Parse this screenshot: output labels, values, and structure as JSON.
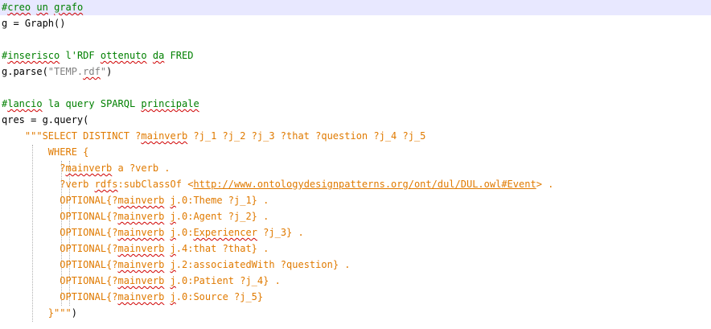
{
  "editor": {
    "lines": [
      {
        "segments": [
          {
            "text": "#",
            "cls": "comment"
          },
          {
            "text": "creo",
            "cls": "comment squiggle"
          },
          {
            "text": " ",
            "cls": "comment"
          },
          {
            "text": "un",
            "cls": "comment squiggle"
          },
          {
            "text": " ",
            "cls": "comment"
          },
          {
            "text": "grafo",
            "cls": "comment squiggle"
          }
        ]
      },
      {
        "segments": [
          {
            "text": "g = Graph()",
            "cls": "kw"
          }
        ]
      },
      {
        "segments": []
      },
      {
        "segments": [
          {
            "text": "#",
            "cls": "comment"
          },
          {
            "text": "inserisco",
            "cls": "comment squiggle"
          },
          {
            "text": " l'RDF ",
            "cls": "comment"
          },
          {
            "text": "ottenuto",
            "cls": "comment squiggle"
          },
          {
            "text": " ",
            "cls": "comment"
          },
          {
            "text": "da",
            "cls": "comment squiggle"
          },
          {
            "text": " FRED",
            "cls": "comment"
          }
        ]
      },
      {
        "segments": [
          {
            "text": "g.parse(",
            "cls": "kw"
          },
          {
            "text": "\"TEMP.",
            "cls": "gray"
          },
          {
            "text": "rdf",
            "cls": "gray squiggle"
          },
          {
            "text": "\"",
            "cls": "gray"
          },
          {
            "text": ")",
            "cls": "kw"
          }
        ]
      },
      {
        "segments": []
      },
      {
        "segments": [
          {
            "text": "#",
            "cls": "comment"
          },
          {
            "text": "lancio",
            "cls": "comment squiggle"
          },
          {
            "text": " la query SPARQL ",
            "cls": "comment"
          },
          {
            "text": "principale",
            "cls": "comment squiggle"
          }
        ]
      },
      {
        "segments": [
          {
            "text": "qres = g.query(",
            "cls": "kw"
          }
        ]
      },
      {
        "segments": [
          {
            "text": "    \"\"\"SELECT DISTINCT ?",
            "cls": "string"
          },
          {
            "text": "mainverb",
            "cls": "string squiggle"
          },
          {
            "text": " ?j_1 ?j_2 ?j_3 ?that ?question ?j_4 ?j_5",
            "cls": "string"
          }
        ]
      },
      {
        "segments": [
          {
            "text": "        WHERE {",
            "cls": "string"
          }
        ]
      },
      {
        "segments": [
          {
            "text": "          ?",
            "cls": "string"
          },
          {
            "text": "mainverb",
            "cls": "string squiggle"
          },
          {
            "text": " a ?verb .",
            "cls": "string"
          }
        ]
      },
      {
        "segments": [
          {
            "text": "          ?verb ",
            "cls": "string"
          },
          {
            "text": "rdfs",
            "cls": "string squiggle"
          },
          {
            "text": ":subClassOf <",
            "cls": "string"
          },
          {
            "text": "http://www.ontologydesignpatterns.org/ont/dul/DUL.owl#Event",
            "cls": "string link"
          },
          {
            "text": "> .",
            "cls": "string"
          }
        ]
      },
      {
        "segments": [
          {
            "text": "          OPTIONAL{?",
            "cls": "string"
          },
          {
            "text": "mainverb",
            "cls": "string squiggle"
          },
          {
            "text": " ",
            "cls": "string"
          },
          {
            "text": "j",
            "cls": "string squiggle"
          },
          {
            "text": ".0:Theme ?j_1} .",
            "cls": "string"
          }
        ]
      },
      {
        "segments": [
          {
            "text": "          OPTIONAL{?",
            "cls": "string"
          },
          {
            "text": "mainverb",
            "cls": "string squiggle"
          },
          {
            "text": " ",
            "cls": "string"
          },
          {
            "text": "j",
            "cls": "string squiggle"
          },
          {
            "text": ".0:Agent ?j_2} .",
            "cls": "string"
          }
        ]
      },
      {
        "segments": [
          {
            "text": "          OPTIONAL{?",
            "cls": "string"
          },
          {
            "text": "mainverb",
            "cls": "string squiggle"
          },
          {
            "text": " ",
            "cls": "string"
          },
          {
            "text": "j",
            "cls": "string squiggle"
          },
          {
            "text": ".0:",
            "cls": "string"
          },
          {
            "text": "Experiencer",
            "cls": "string squiggle"
          },
          {
            "text": " ?j_3} .",
            "cls": "string"
          }
        ]
      },
      {
        "segments": [
          {
            "text": "          OPTIONAL{?",
            "cls": "string"
          },
          {
            "text": "mainverb",
            "cls": "string squiggle"
          },
          {
            "text": " ",
            "cls": "string"
          },
          {
            "text": "j",
            "cls": "string squiggle"
          },
          {
            "text": ".4:that ?that} .",
            "cls": "string"
          }
        ]
      },
      {
        "segments": [
          {
            "text": "          OPTIONAL{?",
            "cls": "string"
          },
          {
            "text": "mainverb",
            "cls": "string squiggle"
          },
          {
            "text": " ",
            "cls": "string"
          },
          {
            "text": "j",
            "cls": "string squiggle"
          },
          {
            "text": ".2:associatedWith ?question} .",
            "cls": "string"
          }
        ]
      },
      {
        "segments": [
          {
            "text": "          OPTIONAL{?",
            "cls": "string"
          },
          {
            "text": "mainverb",
            "cls": "string squiggle"
          },
          {
            "text": " ",
            "cls": "string"
          },
          {
            "text": "j",
            "cls": "string squiggle"
          },
          {
            "text": ".0:Patient ?j_4} .",
            "cls": "string"
          }
        ]
      },
      {
        "segments": [
          {
            "text": "          OPTIONAL{?",
            "cls": "string"
          },
          {
            "text": "mainverb",
            "cls": "string squiggle"
          },
          {
            "text": " ",
            "cls": "string"
          },
          {
            "text": "j",
            "cls": "string squiggle"
          },
          {
            "text": ".0:Source ?j_5}",
            "cls": "string"
          }
        ]
      },
      {
        "segments": [
          {
            "text": "        }\"\"\"",
            "cls": "string"
          },
          {
            "text": ")",
            "cls": "kw"
          }
        ]
      }
    ]
  }
}
